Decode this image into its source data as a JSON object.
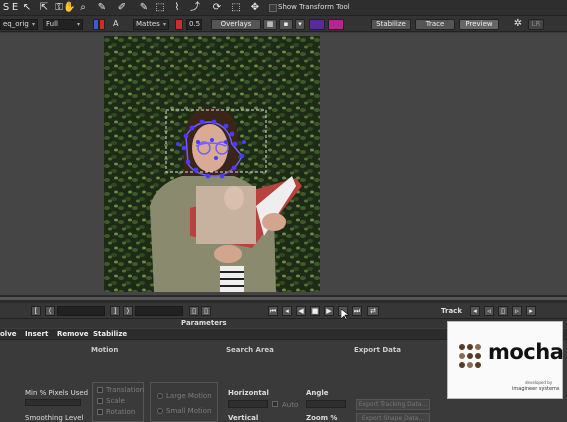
{
  "toolbar": {
    "icons": [
      "arrow-icon",
      "key-icon",
      "hand-icon",
      "zoom-icon",
      "xspline-icon",
      "bezier-icon",
      "add-point-icon",
      "transform-icon",
      "rotate-icon",
      "scale-icon",
      "move-icon"
    ],
    "show_transform_tool": "Show Transform Tool",
    "letter_s": "S",
    "letter_e": "E"
  },
  "options": {
    "clip": "eq_orig",
    "view": "Full",
    "layer_letter": "A",
    "mattes": "Mattes",
    "opacity": "0.5",
    "overlays": "Overlays",
    "stabilize": "Stabilize",
    "trace": "Trace",
    "preview": "Preview",
    "lr": "LR"
  },
  "colors": {
    "matte_blue": "#3a5bd6",
    "matte_red": "#c83030",
    "swatch_purple": "#5a2a9a",
    "swatch_magenta": "#b3268f",
    "spline": "#7060ff",
    "track_point": "#4a3cff",
    "select_box": "#e0e0e0"
  },
  "timeline": {
    "track_label": "Track"
  },
  "parameters": {
    "title": "Parameters",
    "tabs": [
      "olve",
      "Insert",
      "Remove",
      "Stabilize"
    ],
    "sections": {
      "motion": "Motion",
      "search_area": "Search Area",
      "export_data": "Export Data"
    },
    "min_pixels_used": "Min % Pixels Used",
    "smoothing_level": "Smoothing Level",
    "translation": "Translation",
    "scale": "Scale",
    "rotation": "Rotation",
    "large_motion": "Large Motion",
    "small_motion": "Small Motion",
    "horizontal": "Horizontal",
    "vertical": "Vertical",
    "auto": "Auto",
    "angle": "Angle",
    "zoom": "Zoom %",
    "export_tracking_data": "Export Tracking Data...",
    "export_shape_data": "Export Shape Data..."
  },
  "logo": {
    "name": "mocha",
    "developed_by": "developed by",
    "company": "imagineer systems"
  }
}
